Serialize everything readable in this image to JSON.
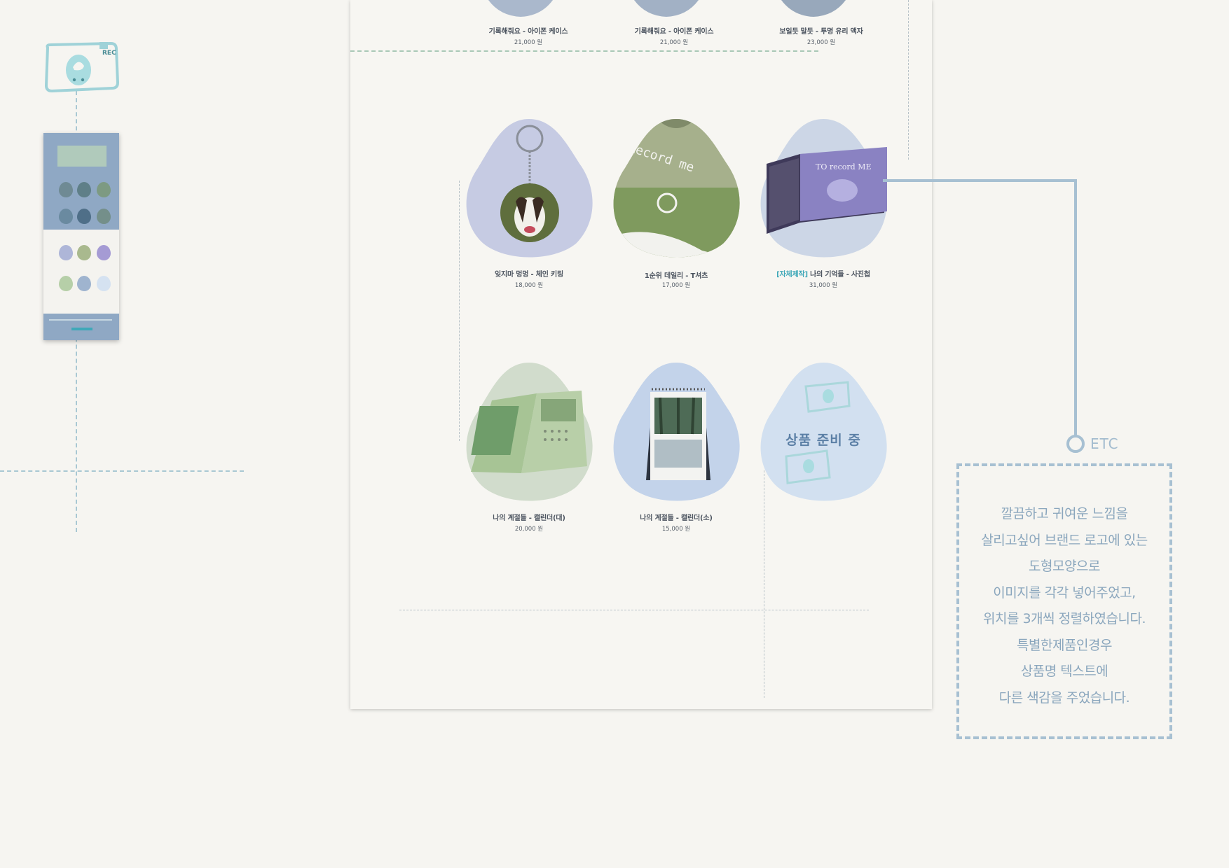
{
  "logo": {
    "badge": "REC"
  },
  "top_products": [
    {
      "name": "기록해줘요 - 아이폰 케이스",
      "price": "21,000 원"
    },
    {
      "name": "기록해줘요 - 아이폰 케이스",
      "price": "21,000 원"
    },
    {
      "name": "보일듯 말듯 - 투명 유리 액자",
      "price": "23,000 원"
    }
  ],
  "products": [
    {
      "name": "잊지마 멍멍 - 체인 키링",
      "price": "18,000 원"
    },
    {
      "name": "1순위 데일리 - T셔츠",
      "price": "17,000 원"
    },
    {
      "name_special": "[자체제작]",
      "name": "나의 기억들 - 사진첩",
      "price": "31,000 원"
    },
    {
      "name": "나의 계절들 - 캘린더(대)",
      "price": "20,000 원"
    },
    {
      "name": "나의 계절들 - 캘린더(소)",
      "price": "15,000 원"
    }
  ],
  "placeholder": {
    "label": "상품 준비 중"
  },
  "annotation": {
    "label": "ETC",
    "lines": [
      "깔끔하고 귀여운 느낌을",
      "살리고싶어 브랜드 로고에 있는",
      "도형모양으로",
      "이미지를 각각 넣어주었고,",
      "위치를 3개씩 정렬하였습니다.",
      "특별한제품인경우",
      "상품명 텍스트에",
      "다른 색감을 주었습니다."
    ]
  },
  "colors": {
    "background": "#f6f5f1",
    "page": "#f7f6f2",
    "accent": "#3fa8b8",
    "annotation": "#8aa6bd",
    "guide": "#a9c8d3"
  }
}
